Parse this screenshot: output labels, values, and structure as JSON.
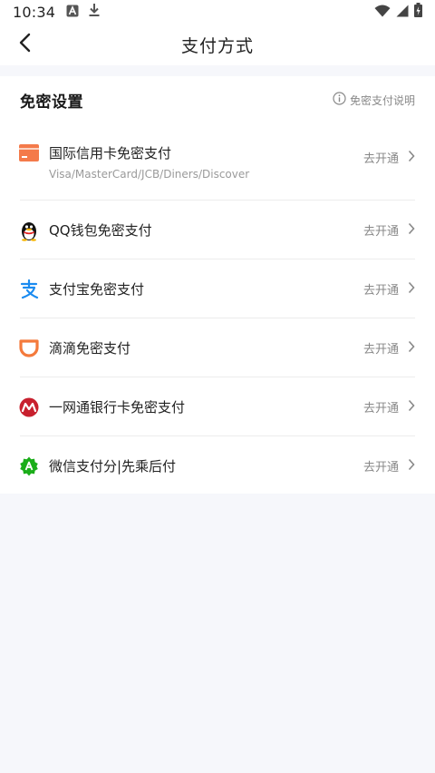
{
  "status_bar": {
    "time": "10:34",
    "left_icons": [
      "font-notification-icon",
      "download-icon"
    ],
    "right_icons": [
      "wifi-icon",
      "cellular-signal-icon",
      "battery-charging-icon"
    ]
  },
  "header": {
    "title": "支付方式",
    "back_icon": "back-arrow-icon"
  },
  "section": {
    "title": "免密设置",
    "help_label": "免密支付说明",
    "help_icon": "info-icon"
  },
  "methods": [
    {
      "title": "国际信用卡免密支付",
      "subtitle": "Visa/MasterCard/JCB/Diners/Discover",
      "action": "去开通",
      "icon": "credit-card-icon",
      "color": "#f47a4a"
    },
    {
      "title": "QQ钱包免密支付",
      "action": "去开通",
      "icon": "qq-penguin-icon",
      "color": "#111111"
    },
    {
      "title": "支付宝免密支付",
      "action": "去开通",
      "icon": "alipay-icon",
      "color": "#1a8bf0"
    },
    {
      "title": "滴滴免密支付",
      "action": "去开通",
      "icon": "didi-icon",
      "color": "#f47a3c"
    },
    {
      "title": "一网通银行卡免密支付",
      "action": "去开通",
      "icon": "cmb-bank-icon",
      "color": "#c8202e"
    },
    {
      "title": "微信支付分|先乘后付",
      "action": "去开通",
      "icon": "wechat-pay-score-icon",
      "color": "#1aad19"
    }
  ],
  "colors": {
    "background": "#f6f7fb",
    "card": "#ffffff",
    "divider": "#ececec",
    "secondary_text": "#888888"
  }
}
